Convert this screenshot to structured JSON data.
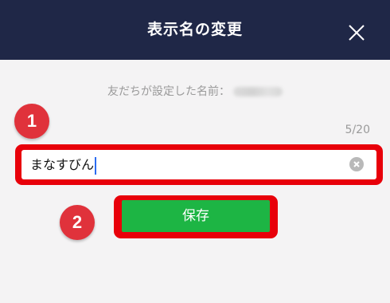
{
  "header": {
    "title": "表示名の変更",
    "close_icon": "close-icon"
  },
  "friend_name": {
    "label": "友だちが設定した名前："
  },
  "name_field": {
    "value": "まなすびん",
    "counter": "5/20",
    "clear_icon": "clear-circle-icon"
  },
  "save_button": {
    "label": "保存"
  },
  "annotations": {
    "badge_1": "1",
    "badge_2": "2"
  },
  "colors": {
    "header_bg": "#1f2747",
    "page_bg": "#f4f3f4",
    "save_green": "#1db544",
    "highlight_red": "#e8000a",
    "badge_red": "#e0323b",
    "caret_blue": "#2b6cf0"
  }
}
